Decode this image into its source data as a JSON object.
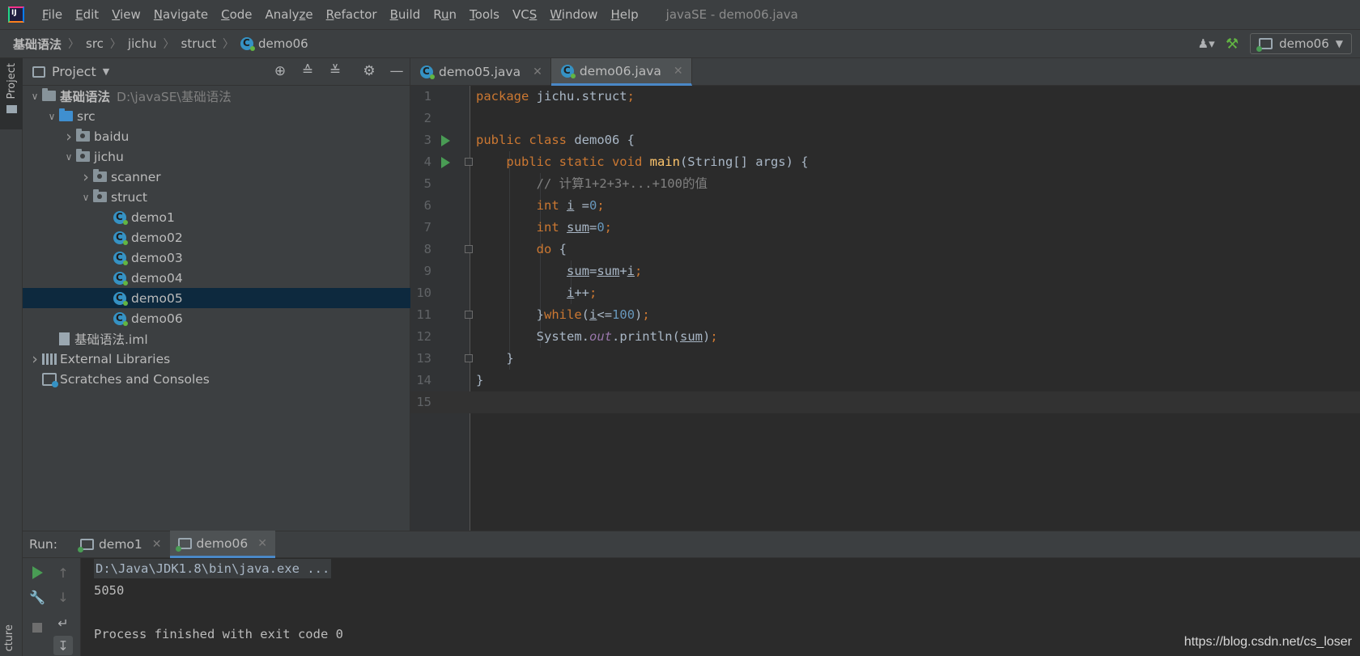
{
  "window": {
    "title": "javaSE - demo06.java"
  },
  "menu": [
    {
      "pre": "",
      "u": "F",
      "post": "ile"
    },
    {
      "pre": "",
      "u": "E",
      "post": "dit"
    },
    {
      "pre": "",
      "u": "V",
      "post": "iew"
    },
    {
      "pre": "",
      "u": "N",
      "post": "avigate"
    },
    {
      "pre": "",
      "u": "C",
      "post": "ode"
    },
    {
      "pre": "Analy",
      "u": "z",
      "post": "e"
    },
    {
      "pre": "",
      "u": "R",
      "post": "efactor"
    },
    {
      "pre": "",
      "u": "B",
      "post": "uild"
    },
    {
      "pre": "R",
      "u": "u",
      "post": "n"
    },
    {
      "pre": "",
      "u": "T",
      "post": "ools"
    },
    {
      "pre": "VC",
      "u": "S",
      "post": ""
    },
    {
      "pre": "",
      "u": "W",
      "post": "indow"
    },
    {
      "pre": "",
      "u": "H",
      "post": "elp"
    }
  ],
  "breadcrumb": [
    "基础语法",
    "src",
    "jichu",
    "struct",
    "demo06"
  ],
  "run_config": {
    "label": "demo06"
  },
  "left_strip": {
    "top_label": "Project",
    "bottom_label": "cture"
  },
  "project_panel": {
    "title": "Project",
    "tree": [
      {
        "label": "基础语法",
        "hint": "D:\\javaSE\\基础语法",
        "depth": 0,
        "arrow": "down",
        "icon": "module",
        "bold": true
      },
      {
        "label": "src",
        "depth": 1,
        "arrow": "down",
        "icon": "src"
      },
      {
        "label": "baidu",
        "depth": 2,
        "arrow": "right",
        "icon": "package"
      },
      {
        "label": "jichu",
        "depth": 2,
        "arrow": "down",
        "icon": "package"
      },
      {
        "label": "scanner",
        "depth": 3,
        "arrow": "right",
        "icon": "package"
      },
      {
        "label": "struct",
        "depth": 3,
        "arrow": "down",
        "icon": "package"
      },
      {
        "label": "demo1",
        "depth": 4,
        "arrow": "",
        "icon": "class"
      },
      {
        "label": "demo02",
        "depth": 4,
        "arrow": "",
        "icon": "class"
      },
      {
        "label": "demo03",
        "depth": 4,
        "arrow": "",
        "icon": "class"
      },
      {
        "label": "demo04",
        "depth": 4,
        "arrow": "",
        "icon": "class"
      },
      {
        "label": "demo05",
        "depth": 4,
        "arrow": "",
        "icon": "class",
        "selected": true
      },
      {
        "label": "demo06",
        "depth": 4,
        "arrow": "",
        "icon": "class"
      },
      {
        "label": "基础语法.iml",
        "depth": 1,
        "arrow": "",
        "icon": "iml"
      },
      {
        "label": "External Libraries",
        "depth": 0,
        "arrow": "right",
        "icon": "lib"
      },
      {
        "label": "Scratches and Consoles",
        "depth": 0,
        "arrow": "",
        "icon": "scratch"
      }
    ]
  },
  "editor": {
    "tabs": [
      {
        "label": "demo05.java",
        "active": false
      },
      {
        "label": "demo06.java",
        "active": true
      }
    ],
    "current_line": 15,
    "lines": [
      {
        "n": "1",
        "tokens": [
          [
            "kw",
            "package "
          ],
          [
            "",
            "jichu.struct"
          ],
          [
            "kw",
            ";"
          ]
        ]
      },
      {
        "n": "2",
        "tokens": []
      },
      {
        "n": "3",
        "run": true,
        "tokens": [
          [
            "kw",
            "public class "
          ],
          [
            "",
            "demo06 {"
          ]
        ]
      },
      {
        "n": "4",
        "run": true,
        "fold": true,
        "tokens": [
          [
            "",
            "    "
          ],
          [
            "kw",
            "public static void "
          ],
          [
            "fn",
            "main"
          ],
          [
            "",
            "(String[] args) {"
          ]
        ]
      },
      {
        "n": "5",
        "tokens": [
          [
            "",
            "        "
          ],
          [
            "cm",
            "// 计算1+2+3+...+100的值"
          ]
        ]
      },
      {
        "n": "6",
        "tokens": [
          [
            "",
            "        "
          ],
          [
            "kw",
            "int "
          ],
          [
            "ul",
            "i"
          ],
          [
            "",
            " ="
          ],
          [
            "num",
            "0"
          ],
          [
            "kw",
            ";"
          ]
        ]
      },
      {
        "n": "7",
        "tokens": [
          [
            "",
            "        "
          ],
          [
            "kw",
            "int "
          ],
          [
            "ul",
            "sum"
          ],
          [
            "",
            "="
          ],
          [
            "num",
            "0"
          ],
          [
            "kw",
            ";"
          ]
        ]
      },
      {
        "n": "8",
        "fold": true,
        "tokens": [
          [
            "",
            "        "
          ],
          [
            "kw",
            "do "
          ],
          [
            "",
            "{"
          ]
        ]
      },
      {
        "n": "9",
        "tokens": [
          [
            "",
            "            "
          ],
          [
            "ul",
            "sum"
          ],
          [
            "",
            "="
          ],
          [
            "ul",
            "sum"
          ],
          [
            "",
            "+"
          ],
          [
            "ul",
            "i"
          ],
          [
            "kw",
            ";"
          ]
        ]
      },
      {
        "n": "10",
        "tokens": [
          [
            "",
            "            "
          ],
          [
            "ul",
            "i"
          ],
          [
            "",
            "++"
          ],
          [
            "kw",
            ";"
          ]
        ]
      },
      {
        "n": "11",
        "fold": true,
        "tokens": [
          [
            "",
            "        }"
          ],
          [
            "kw",
            "while"
          ],
          [
            "",
            "("
          ],
          [
            "ul",
            "i"
          ],
          [
            "",
            "<="
          ],
          [
            "num",
            "100"
          ],
          [
            "",
            ")"
          ],
          [
            "kw",
            ";"
          ]
        ]
      },
      {
        "n": "12",
        "tokens": [
          [
            "",
            "        System."
          ],
          [
            "field",
            "out"
          ],
          [
            "",
            ".println("
          ],
          [
            "ul",
            "sum"
          ],
          [
            "",
            ")"
          ],
          [
            "kw",
            ";"
          ]
        ]
      },
      {
        "n": "13",
        "fold": true,
        "tokens": [
          [
            "",
            "    }"
          ]
        ]
      },
      {
        "n": "14",
        "tokens": [
          [
            "",
            "}"
          ]
        ]
      },
      {
        "n": "15",
        "tokens": []
      }
    ]
  },
  "run_panel": {
    "label": "Run:",
    "tabs": [
      {
        "label": "demo1",
        "active": false
      },
      {
        "label": "demo06",
        "active": true
      }
    ],
    "console": {
      "command": "D:\\Java\\JDK1.8\\bin\\java.exe ...",
      "output": "5050",
      "blank": "",
      "exit": "Process finished with exit code 0"
    }
  },
  "watermark": "https://blog.csdn.net/cs_loser"
}
